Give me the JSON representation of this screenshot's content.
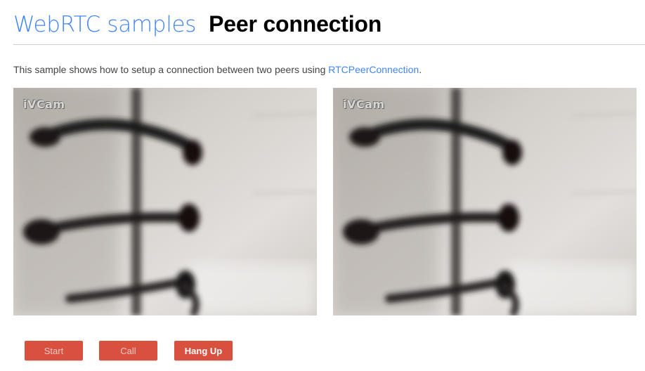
{
  "header": {
    "site_link": "WebRTC samples",
    "page_title": "Peer connection"
  },
  "intro": {
    "text": "This sample shows how to setup a connection between two peers using ",
    "link": "RTCPeerConnection",
    "suffix": "."
  },
  "videos": {
    "local": {
      "watermark": "iVCam"
    },
    "remote": {
      "watermark": "iVCam"
    }
  },
  "buttons": {
    "start": "Start",
    "call": "Call",
    "hangup": "Hang Up"
  },
  "colors": {
    "link": "#4285f4",
    "button": "#d9503f",
    "divider": "#cfcfcf"
  }
}
